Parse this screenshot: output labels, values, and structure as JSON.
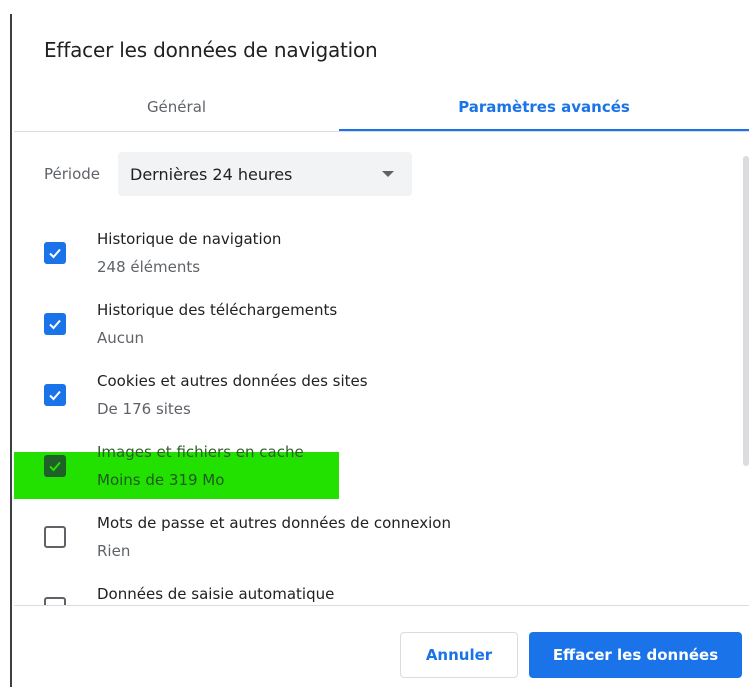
{
  "dialog": {
    "title": "Effacer les données de navigation"
  },
  "tabs": [
    {
      "label": "Général",
      "active": false
    },
    {
      "label": "Paramètres avancés",
      "active": true
    }
  ],
  "period": {
    "label": "Période",
    "selected": "Dernières 24 heures"
  },
  "items": [
    {
      "label": "Historique de navigation",
      "detail": "248 éléments",
      "checked": true
    },
    {
      "label": "Historique des téléchargements",
      "detail": "Aucun",
      "checked": true
    },
    {
      "label": "Cookies et autres données des sites",
      "detail": "De 176 sites",
      "checked": true
    },
    {
      "label": "Images et fichiers en cache",
      "detail": "Moins de 319 Mo",
      "checked": true,
      "highlighted": true
    },
    {
      "label": "Mots de passe et autres données de connexion",
      "detail": "Rien",
      "checked": false
    },
    {
      "label": "Données de saisie automatique",
      "detail": "",
      "checked": false
    }
  ],
  "buttons": {
    "cancel": "Annuler",
    "clear": "Effacer les données"
  },
  "colors": {
    "accent": "#1a73e8",
    "highlight": "#22e000",
    "select_bg": "#f1f3f4"
  }
}
